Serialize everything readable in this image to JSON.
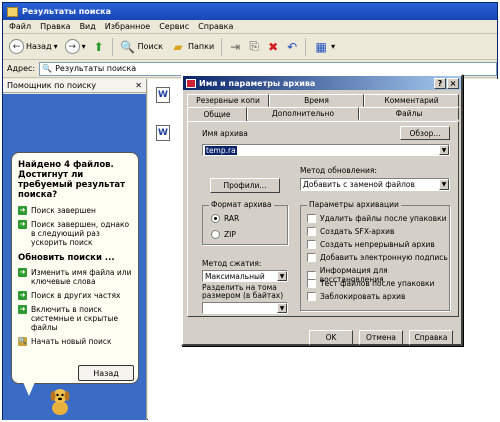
{
  "window": {
    "title": "Результаты поиска"
  },
  "menu": [
    "Файл",
    "Правка",
    "Вид",
    "Избранное",
    "Сервис",
    "Справка"
  ],
  "toolbar": {
    "back": "Назад",
    "search": "Поиск",
    "folders": "Папки"
  },
  "address": {
    "label": "Адрес:",
    "value": "Результаты поиска"
  },
  "left_pane": {
    "header": "Помощник по поиску",
    "bubble": {
      "heading": "Найдено 4 файлов. Достигнут ли требуемый результат поиска?",
      "items": [
        "Поиск завершен",
        "Поиск завершен, однако в следующий раз ускорить поиск"
      ],
      "heading2": "Обновить поиски ...",
      "items2": [
        "Изменить имя файла или ключевые слова",
        "Поиск в других частях",
        "Включить в поиск системные и скрытые файлы",
        "Начать новый поиск"
      ],
      "back_button": "Назад"
    }
  },
  "dialog": {
    "title": "Имя и параметры архива",
    "tabs_back": [
      "Резервные копи",
      "Время",
      "Комментарий"
    ],
    "tabs_front": [
      "Общие",
      "Дополнительно",
      "Файлы"
    ],
    "archive_name_label": "Имя архива",
    "browse_button": "Обзор...",
    "archive_name_value": "temp.ra",
    "profiles_button": "Профили...",
    "update_method_label": "Метод обновления:",
    "update_method_value": "Добавить с заменой файлов",
    "format_group": "Формат архива",
    "format_rar": "RAR",
    "format_zip": "ZIP",
    "options_group": "Параметры архивации",
    "options": [
      "Удалить файлы после упаковки",
      "Создать SFX-архив",
      "Создать непрерывный архив",
      "Добавить электронную подпись",
      "Информация для восстановления",
      "Тест файлов после упаковки",
      "Заблокировать архив"
    ],
    "compression_label": "Метод сжатия:",
    "compression_value": "Максимальный",
    "split_label": "Разделить на тома размером (в байтах)",
    "ok": "OK",
    "cancel": "Отмена",
    "help": "Справка"
  }
}
